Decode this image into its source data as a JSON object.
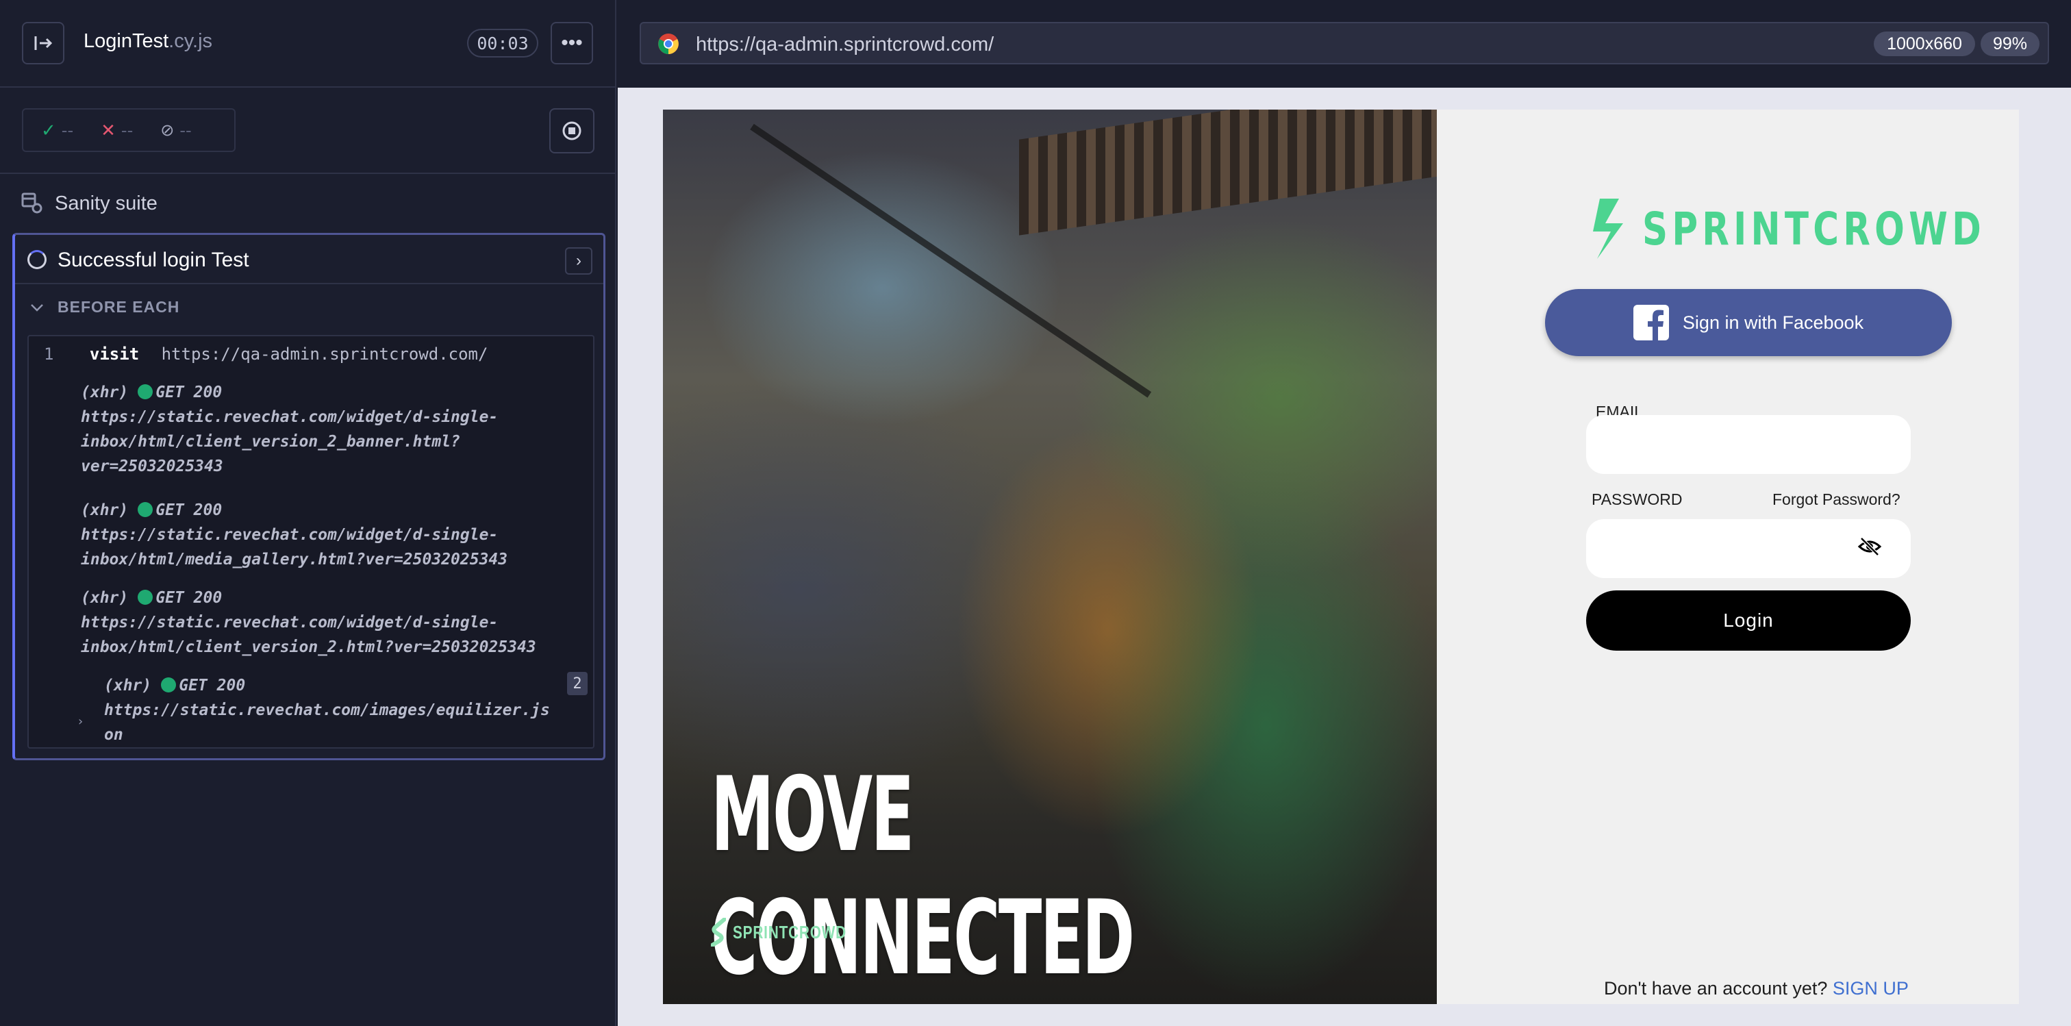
{
  "reporter": {
    "spec_name": "LoginTest",
    "spec_ext": ".cy.js",
    "timer": "00:03",
    "stats": {
      "passed": "--",
      "failed": "--",
      "pending": "--"
    },
    "suite_title": "Sanity suite",
    "test_title": "Successful login Test",
    "hook_title": "BEFORE EACH",
    "commands": [
      {
        "num": "1",
        "name": "visit",
        "message": "https://qa-admin.sprintcrowd.com/"
      }
    ],
    "xhr_logs": [
      {
        "label": "(xhr)",
        "status": "GET 200",
        "lines": [
          "https://static.revechat.com/widget/d-single-",
          "inbox/html/client_version_2_banner.html?",
          "ver=25032025343"
        ]
      },
      {
        "label": "(xhr)",
        "status": "GET 200",
        "lines": [
          "https://static.revechat.com/widget/d-single-",
          "inbox/html/media_gallery.html?ver=25032025343"
        ]
      },
      {
        "label": "(xhr)",
        "status": "GET 200",
        "lines": [
          "https://static.revechat.com/widget/d-single-",
          "inbox/html/client_version_2.html?ver=25032025343"
        ]
      },
      {
        "label": "(xhr)",
        "status": "GET 200",
        "count": "2",
        "lines": [
          "https://static.revechat.com/images/equilizer.js",
          "on"
        ]
      }
    ]
  },
  "aut": {
    "url": "https://qa-admin.sprintcrowd.com/",
    "viewport": "1000x660",
    "zoom": "99%"
  },
  "app": {
    "hero_title_line1": "MOVE",
    "hero_title_line2": "CONNECTED",
    "hero_logo_text": "SPRINTCROWD",
    "brand_text": "SPRINTCROWD",
    "facebook_button": "Sign in with Facebook",
    "email_label": "EMAIL",
    "email_value": "",
    "password_label": "PASSWORD",
    "password_value": "",
    "forgot_password": "Forgot Password?",
    "login_button": "Login",
    "signup_prompt": "Don't have an account yet?",
    "signup_link": "SIGN UP",
    "brand_color": "#4cd490",
    "facebook_color": "#4a5a9b"
  }
}
